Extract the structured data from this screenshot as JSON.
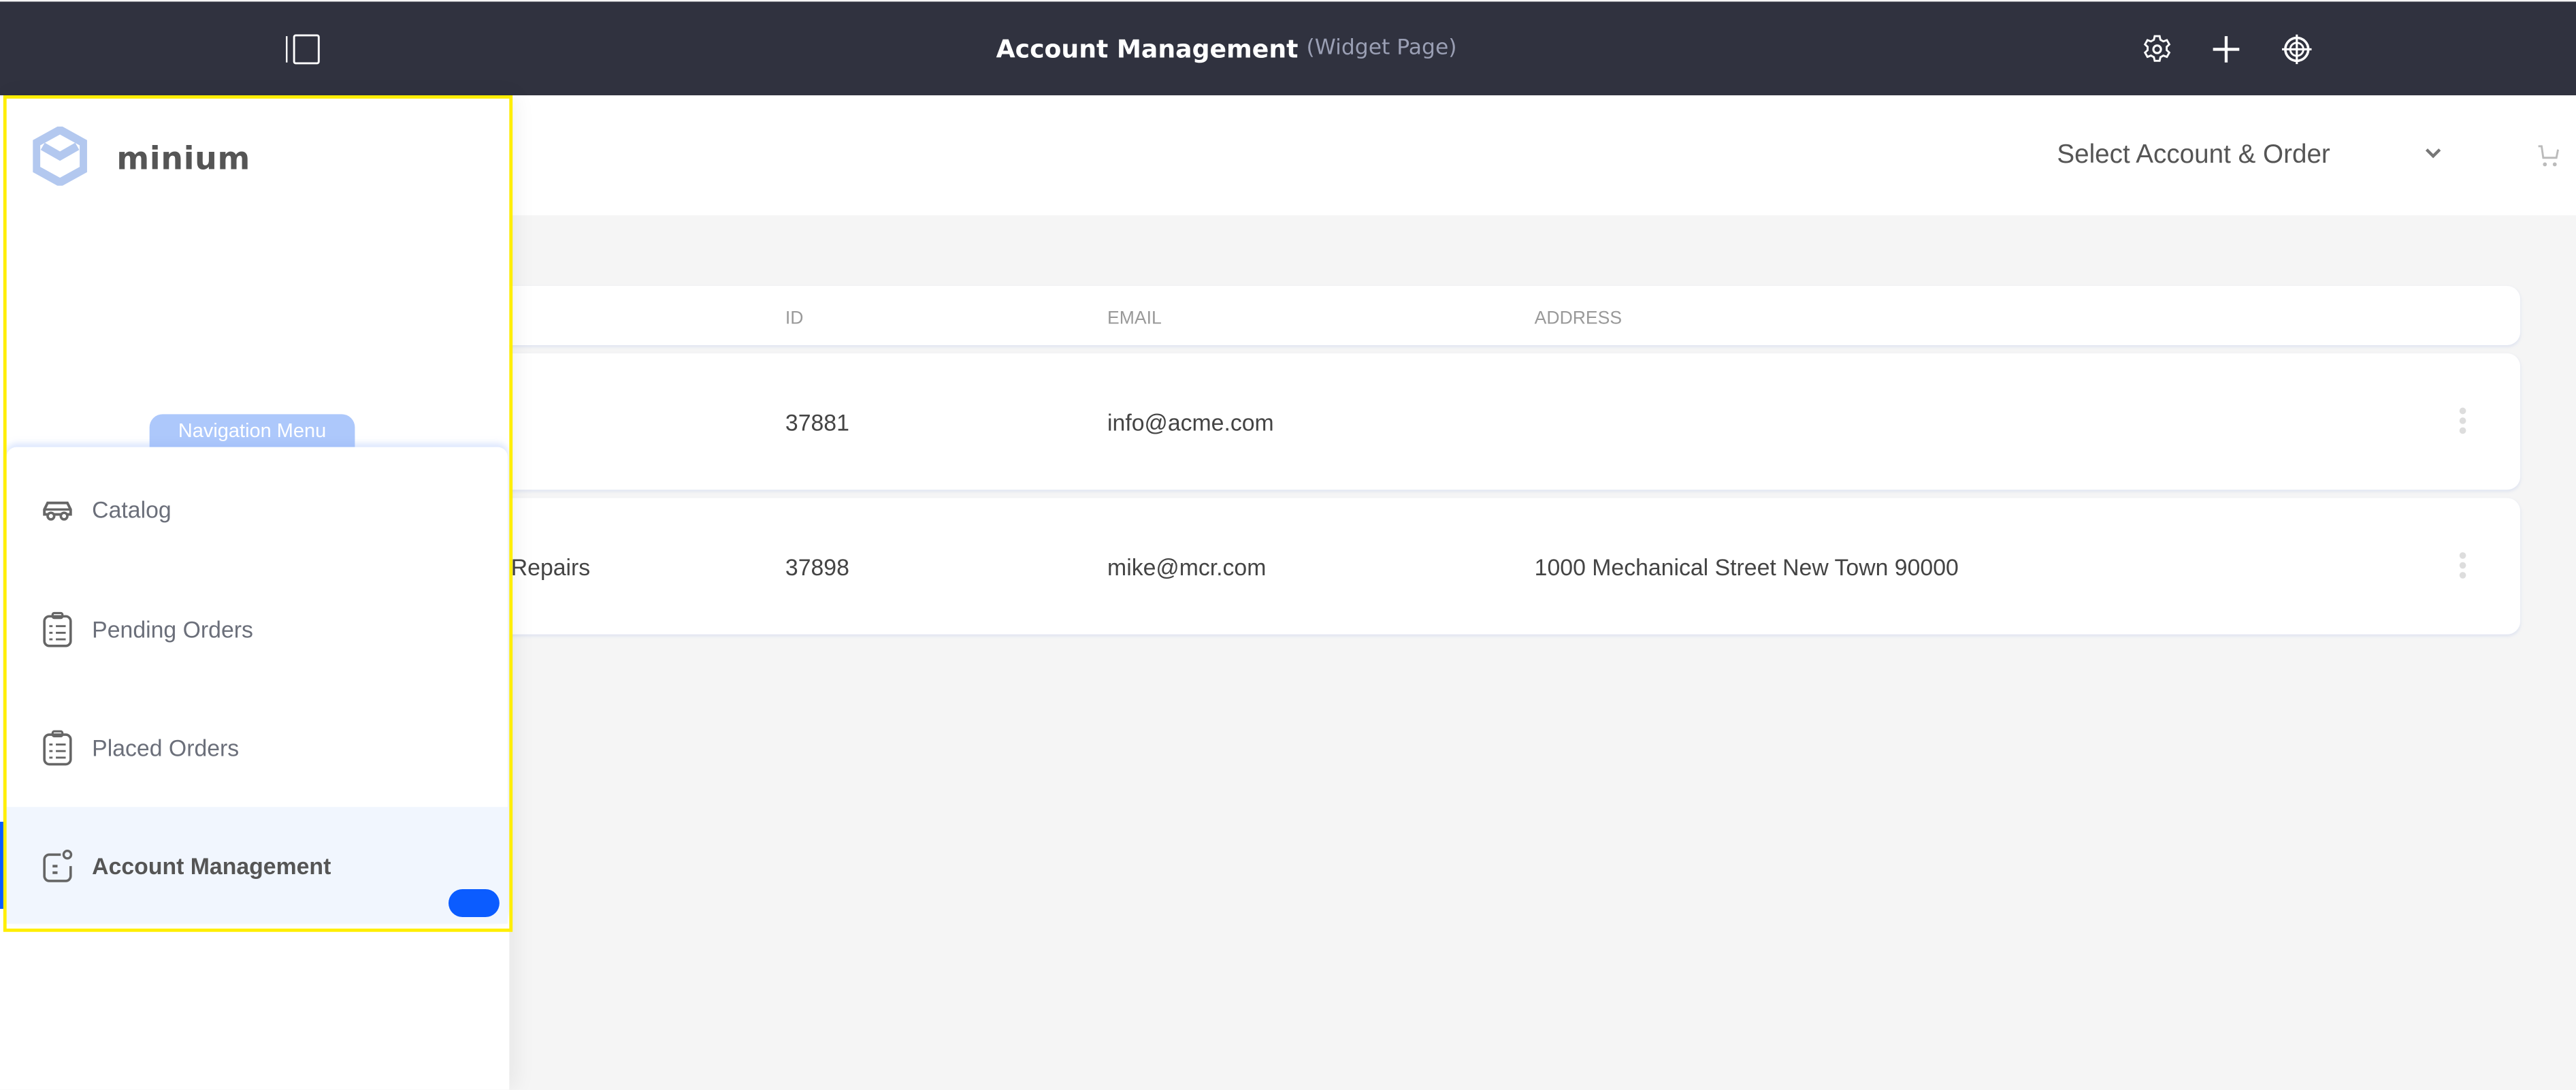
{
  "topbar": {
    "title": "Account Management",
    "subtitle": "(Widget Page)",
    "icons": [
      "sidebar-toggle-icon",
      "gear-icon",
      "plus-icon",
      "target-icon"
    ]
  },
  "header": {
    "select_label": "Select Account & Order",
    "cart_icon": "cart-icon"
  },
  "table": {
    "columns": [
      "ID",
      "EMAIL",
      "ADDRESS"
    ],
    "rows": [
      {
        "name": "",
        "id": "37881",
        "email": "info@acme.com",
        "address": ""
      },
      {
        "name": "Repairs",
        "id": "37898",
        "email": "mike@mcr.com",
        "address": "1000 Mechanical Street New Town 90000"
      }
    ]
  },
  "sidebar": {
    "logo_text": "minium",
    "nav_title": "Navigation Menu",
    "items": [
      {
        "label": "Catalog",
        "icon": "car-icon"
      },
      {
        "label": "Pending Orders",
        "icon": "clipboard-list-icon"
      },
      {
        "label": "Placed Orders",
        "icon": "clipboard-list-icon"
      },
      {
        "label": "Account Management",
        "icon": "account-icon",
        "active": true
      }
    ]
  },
  "colors": {
    "topbar": "#30323f",
    "accent": "#0b5cff",
    "nav_pill": "#adc8fb",
    "highlight": "#ffee00"
  }
}
